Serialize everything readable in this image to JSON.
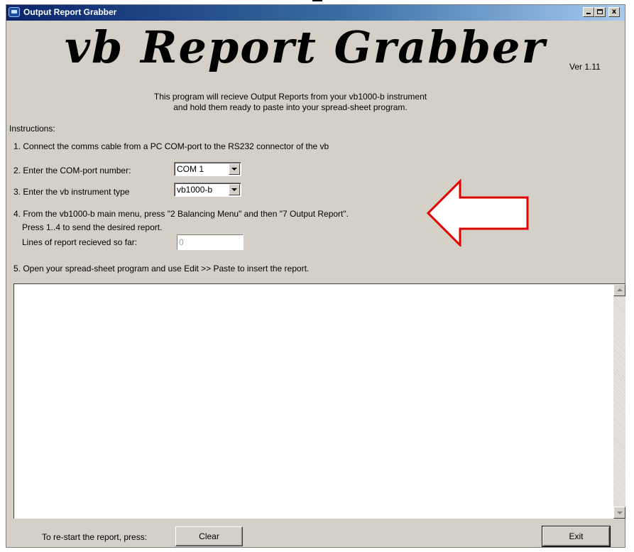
{
  "window": {
    "title": "Output Report Grabber",
    "minimize_label": "",
    "maximize_label": "",
    "close_label": "x"
  },
  "header": {
    "logo_text": "vb Report Grabber",
    "version": "Ver 1.11"
  },
  "intro": {
    "line1": "This program will recieve Output Reports from your vb1000-b instrument",
    "line2": "and hold them ready to paste into your spread-sheet program."
  },
  "instructions": {
    "heading": "Instructions:",
    "step1": "1. Connect the comms cable from a PC COM-port to the  RS232 connector of the vb",
    "step2": "2. Enter the COM-port number:",
    "step3": "3. Enter the vb instrument type",
    "step4_line1": "4. From the vb1000-b main menu, press \"2 Balancing Menu\" and then \"7 Output Report\".",
    "step4_line2": "Press 1..4 to send the desired report.",
    "step4_line3": "Lines of report recieved so far:",
    "step5": "5. Open your spread-sheet program and use Edit >> Paste to insert the report."
  },
  "com_port": {
    "selected": "COM 1"
  },
  "instrument_type": {
    "selected": "vb1000-b"
  },
  "lines_received": {
    "value": "0"
  },
  "report": {
    "text": ""
  },
  "footer": {
    "restart_label": "To re-start the report, press:",
    "clear_label": "Clear",
    "exit_label": "Exit"
  },
  "colors": {
    "window_face": "#d4d0c8",
    "titlebar_start": "#0a246a",
    "titlebar_end": "#a6caf0",
    "annotation_arrow": "#e00000"
  },
  "icons": [
    "app-icon",
    "minimize-icon",
    "maximize-icon",
    "close-icon",
    "dropdown-arrow-icon",
    "scroll-up-icon",
    "scroll-down-icon",
    "red-arrow-icon"
  ]
}
